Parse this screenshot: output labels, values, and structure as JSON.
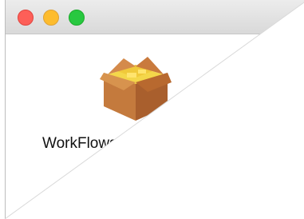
{
  "window": {
    "controls": [
      {
        "name": "close",
        "color": "#fd5f58"
      },
      {
        "name": "minimize",
        "color": "#fdbc2e"
      },
      {
        "name": "zoom",
        "color": "#28c840"
      }
    ]
  },
  "files": [
    {
      "label": "WorkFlows",
      "icon": "package-icon"
    }
  ]
}
